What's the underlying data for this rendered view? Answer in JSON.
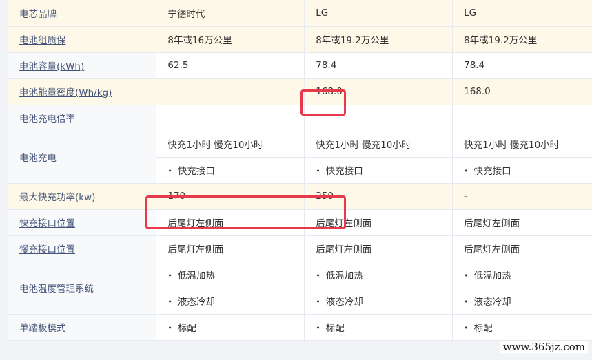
{
  "rows": {
    "brand": {
      "label": "电芯品牌",
      "values": [
        "宁德时代",
        "LG",
        "LG"
      ]
    },
    "warranty": {
      "label": "电池组质保",
      "values": [
        "8年或16万公里",
        "8年或19.2万公里",
        "8年或19.2万公里"
      ]
    },
    "capacity": {
      "label": "电池容量(kWh)",
      "values": [
        "62.5",
        "78.4",
        "78.4"
      ]
    },
    "density": {
      "label": "电池能量密度(Wh/kg)",
      "values": [
        "-",
        "168.0",
        "168.0"
      ]
    },
    "charge_rate": {
      "label": "电池充电倍率",
      "values": [
        "-",
        "-",
        "-"
      ]
    },
    "charging": {
      "label": "电池充电",
      "time_values": [
        "快充1小时 慢充10小时",
        "快充1小时 慢充10小时",
        "快充1小时 慢充10小时"
      ],
      "port_values": [
        "快充接口",
        "快充接口",
        "快充接口"
      ]
    },
    "max_power": {
      "label": "最大快充功率(kw)",
      "values": [
        "170",
        "250",
        "-"
      ]
    },
    "fast_port_pos": {
      "label": "快充接口位置",
      "values": [
        "后尾灯左侧面",
        "后尾灯左侧面",
        "后尾灯左侧面"
      ]
    },
    "slow_port_pos": {
      "label": "慢充接口位置",
      "values": [
        "后尾灯左侧面",
        "后尾灯左侧面",
        "后尾灯左侧面"
      ]
    },
    "thermal": {
      "label": "电池温度管理系统",
      "heat_values": [
        "低温加热",
        "低温加热",
        "低温加热"
      ],
      "cool_values": [
        "液态冷却",
        "液态冷却",
        "液态冷却"
      ]
    },
    "one_pedal": {
      "label": "单踏板模式",
      "values": [
        "标配",
        "标配",
        "标配"
      ]
    }
  },
  "watermark": "www.365jz.com"
}
